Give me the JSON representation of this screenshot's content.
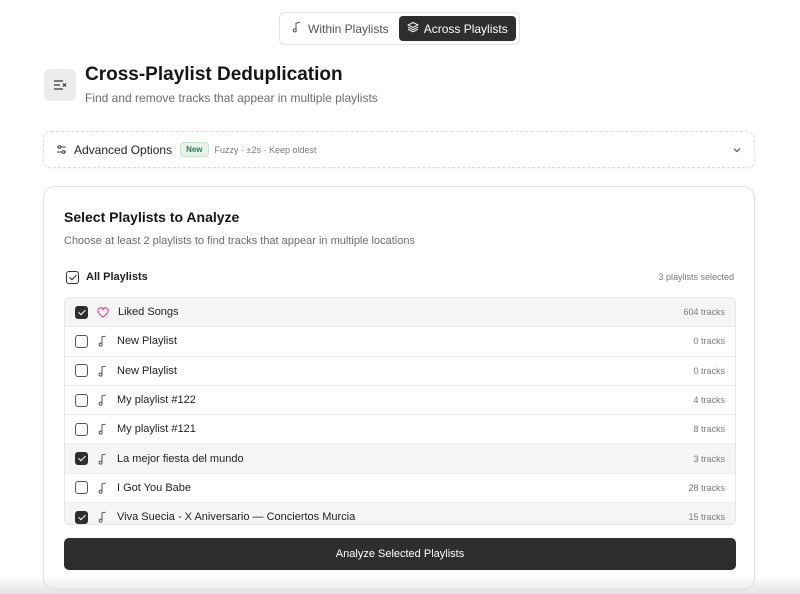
{
  "mode_toggle": {
    "options": [
      {
        "label": "Within Playlists",
        "icon": "music-note-icon",
        "active": false
      },
      {
        "label": "Across Playlists",
        "icon": "layers-icon",
        "active": true
      }
    ]
  },
  "header": {
    "icon": "list-remove-icon",
    "title": "Cross-Playlist Deduplication",
    "subtitle": "Find and remove tracks that appear in multiple playlists"
  },
  "advanced_options": {
    "label": "Advanced Options",
    "badge": "New",
    "summary": "Fuzzy · ±2s · Keep oldest",
    "expanded": false
  },
  "selection": {
    "title": "Select Playlists to Analyze",
    "description": "Choose at least 2 playlists to find tracks that appear in multiple locations",
    "all_label": "All Playlists",
    "selected_count": "3 playlists selected",
    "playlists": [
      {
        "name": "Liked Songs",
        "tracks": "604 tracks",
        "checked": true,
        "icon": "heart-icon"
      },
      {
        "name": "New Playlist",
        "tracks": "0 tracks",
        "checked": false,
        "icon": "music-note-icon"
      },
      {
        "name": "New Playlist",
        "tracks": "0 tracks",
        "checked": false,
        "icon": "music-note-icon"
      },
      {
        "name": "My playlist #122",
        "tracks": "4 tracks",
        "checked": false,
        "icon": "music-note-icon"
      },
      {
        "name": "My playlist #121",
        "tracks": "8 tracks",
        "checked": false,
        "icon": "music-note-icon"
      },
      {
        "name": "La mejor fiesta del mundo",
        "tracks": "3 tracks",
        "checked": true,
        "icon": "music-note-icon"
      },
      {
        "name": "I Got You Babe",
        "tracks": "28 tracks",
        "checked": false,
        "icon": "music-note-icon"
      },
      {
        "name": "Viva Suecia - X Aniversario — Conciertos Murcia",
        "tracks": "15 tracks",
        "checked": true,
        "icon": "music-note-icon"
      }
    ],
    "analyze_label": "Analyze Selected Playlists"
  },
  "colors": {
    "accent_dark": "#2e2e2e",
    "heart_pink": "#e0458f",
    "badge_green": "#2e7d4f"
  }
}
